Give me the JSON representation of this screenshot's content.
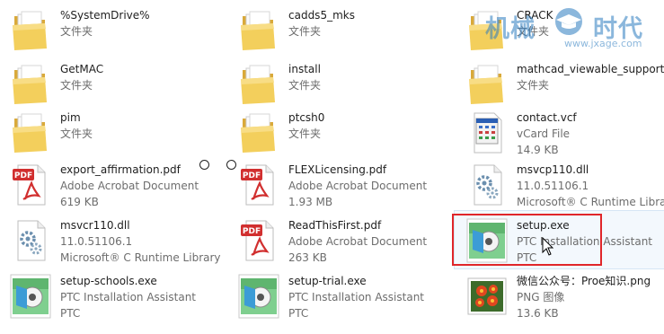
{
  "files": [
    {
      "name": "%SystemDrive%",
      "line2": "文件夹",
      "line3": "",
      "icon": "folder-icon"
    },
    {
      "name": "cadds5_mks",
      "line2": "文件夹",
      "line3": "",
      "icon": "folder-icon"
    },
    {
      "name": "CRACK",
      "line2": "文件夹",
      "line3": "",
      "icon": "folder-icon"
    },
    {
      "name": "GetMAC",
      "line2": "文件夹",
      "line3": "",
      "icon": "folder-icon"
    },
    {
      "name": "install",
      "line2": "文件夹",
      "line3": "",
      "icon": "folder-icon"
    },
    {
      "name": "mathcad_viewable_support",
      "line2": "文件夹",
      "line3": "",
      "icon": "folder-icon"
    },
    {
      "name": "pim",
      "line2": "文件夹",
      "line3": "",
      "icon": "folder-icon"
    },
    {
      "name": "ptcsh0",
      "line2": "文件夹",
      "line3": "",
      "icon": "folder-icon"
    },
    {
      "name": "contact.vcf",
      "line2": "vCard File",
      "line3": "14.9 KB",
      "icon": "vcard-file-icon"
    },
    {
      "name": "export_affirmation.pdf",
      "line2": "Adobe Acrobat Document",
      "line3": "619 KB",
      "icon": "pdf-file-icon"
    },
    {
      "name": "FLEXLicensing.pdf",
      "line2": "Adobe Acrobat Document",
      "line3": "1.93 MB",
      "icon": "pdf-file-icon"
    },
    {
      "name": "msvcp110.dll",
      "line2": "11.0.51106.1",
      "line3": "Microsoft® C Runtime Library",
      "icon": "dll-file-icon"
    },
    {
      "name": "msvcr110.dll",
      "line2": "11.0.51106.1",
      "line3": "Microsoft® C Runtime Library",
      "icon": "dll-file-icon"
    },
    {
      "name": "ReadThisFirst.pdf",
      "line2": "Adobe Acrobat Document",
      "line3": "263 KB",
      "icon": "pdf-file-icon"
    },
    {
      "name": "setup.exe",
      "line2": "PTC Installation Assistant",
      "line3": "PTC",
      "icon": "ptc-installer-icon"
    },
    {
      "name": "setup-schools.exe",
      "line2": "PTC Installation Assistant",
      "line3": "PTC",
      "icon": "ptc-installer-icon"
    },
    {
      "name": "setup-trial.exe",
      "line2": "PTC Installation Assistant",
      "line3": "PTC",
      "icon": "ptc-installer-icon"
    },
    {
      "name": "微信公众号：Proe知识.png",
      "line2": "PNG 图像",
      "line3": "13.6 KB",
      "icon": "png-image-icon"
    }
  ],
  "selected_file": "setup.exe",
  "colors": {
    "highlight_border": "#e0262a",
    "hover_background": "#f3f8fd",
    "folder_yellow": "#f3cf5c",
    "pdf_red": "#d12f2f"
  },
  "watermark": {
    "brand": "机械时代",
    "url": "www.jxage.com"
  }
}
